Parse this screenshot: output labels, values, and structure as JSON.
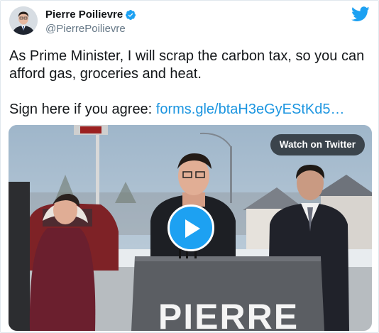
{
  "tweet": {
    "author": {
      "display_name": "Pierre Poilievre",
      "handle": "@PierrePoilievre",
      "verified": true,
      "avatar_icon": "profile-photo"
    },
    "brand_icon": "twitter-bird-icon",
    "brand_color": "#1da1f2",
    "text": {
      "line1": "As Prime Minister, I will scrap the carbon tax, so you can afford gas, groceries and heat.",
      "line2_prefix": "Sign here if you agree: ",
      "link": "forms.gle/btaH3eGyEStKd5…"
    },
    "link_color": "#1b95e0",
    "media": {
      "watch_label": "Watch on Twitter",
      "play_icon": "play-icon",
      "podium_text": "PIERRE"
    }
  }
}
